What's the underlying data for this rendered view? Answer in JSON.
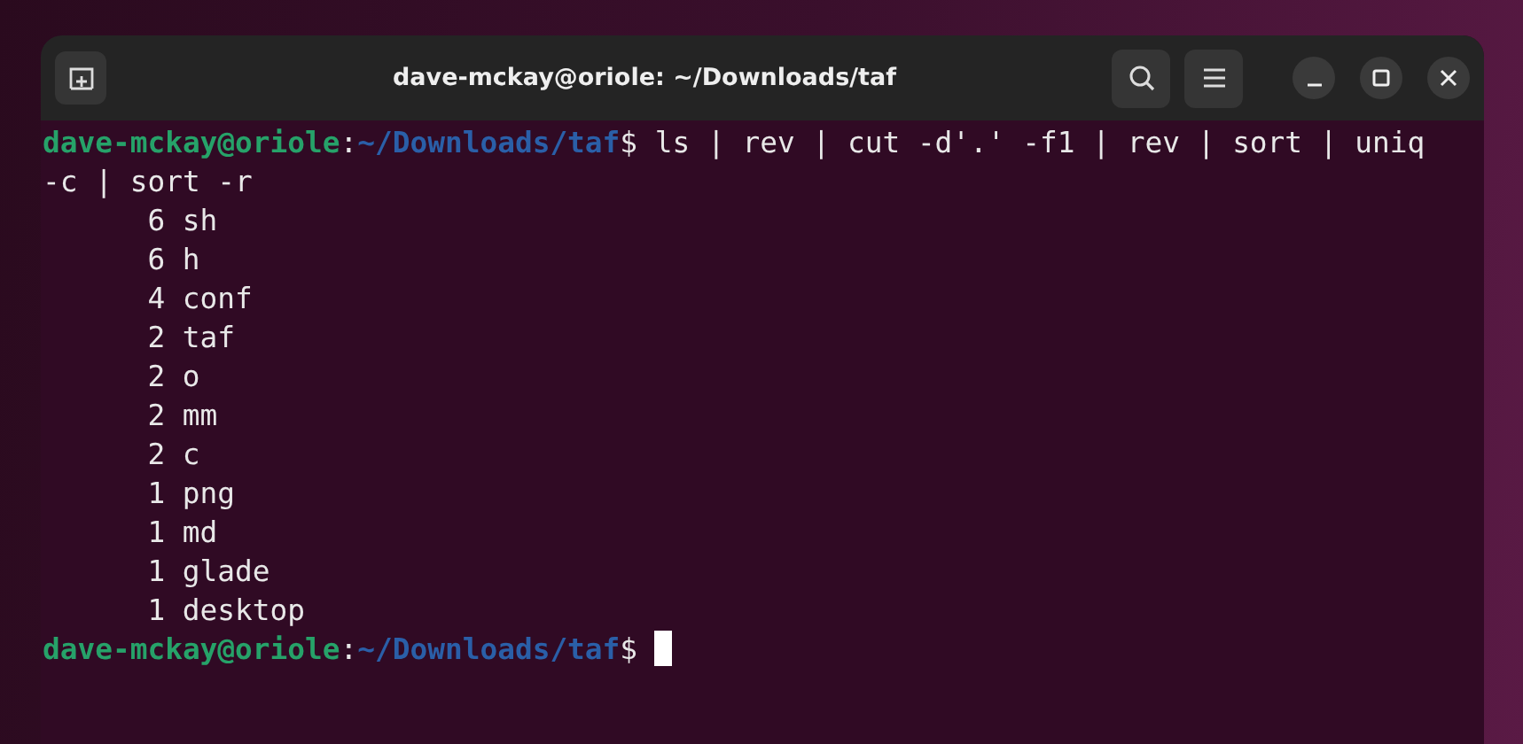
{
  "window": {
    "title": "dave-mckay@oriole: ~/Downloads/taf"
  },
  "terminal": {
    "prompts": [
      {
        "user_host": "dave-mckay@oriole",
        "separator": ":",
        "path": "~/Downloads/taf",
        "symbol": "$"
      },
      {
        "user_host": "dave-mckay@oriole",
        "separator": ":",
        "path": "~/Downloads/taf",
        "symbol": "$"
      }
    ],
    "command_lines": [
      "ls | rev | cut -d'.' -f1 | rev | sort | uniq",
      "-c | sort -r"
    ],
    "output": [
      {
        "count": "6",
        "name": "sh"
      },
      {
        "count": "6",
        "name": "h"
      },
      {
        "count": "4",
        "name": "conf"
      },
      {
        "count": "2",
        "name": "taf"
      },
      {
        "count": "2",
        "name": "o"
      },
      {
        "count": "2",
        "name": "mm"
      },
      {
        "count": "2",
        "name": "c"
      },
      {
        "count": "1",
        "name": "png"
      },
      {
        "count": "1",
        "name": "md"
      },
      {
        "count": "1",
        "name": "glade"
      },
      {
        "count": "1",
        "name": "desktop"
      }
    ]
  }
}
